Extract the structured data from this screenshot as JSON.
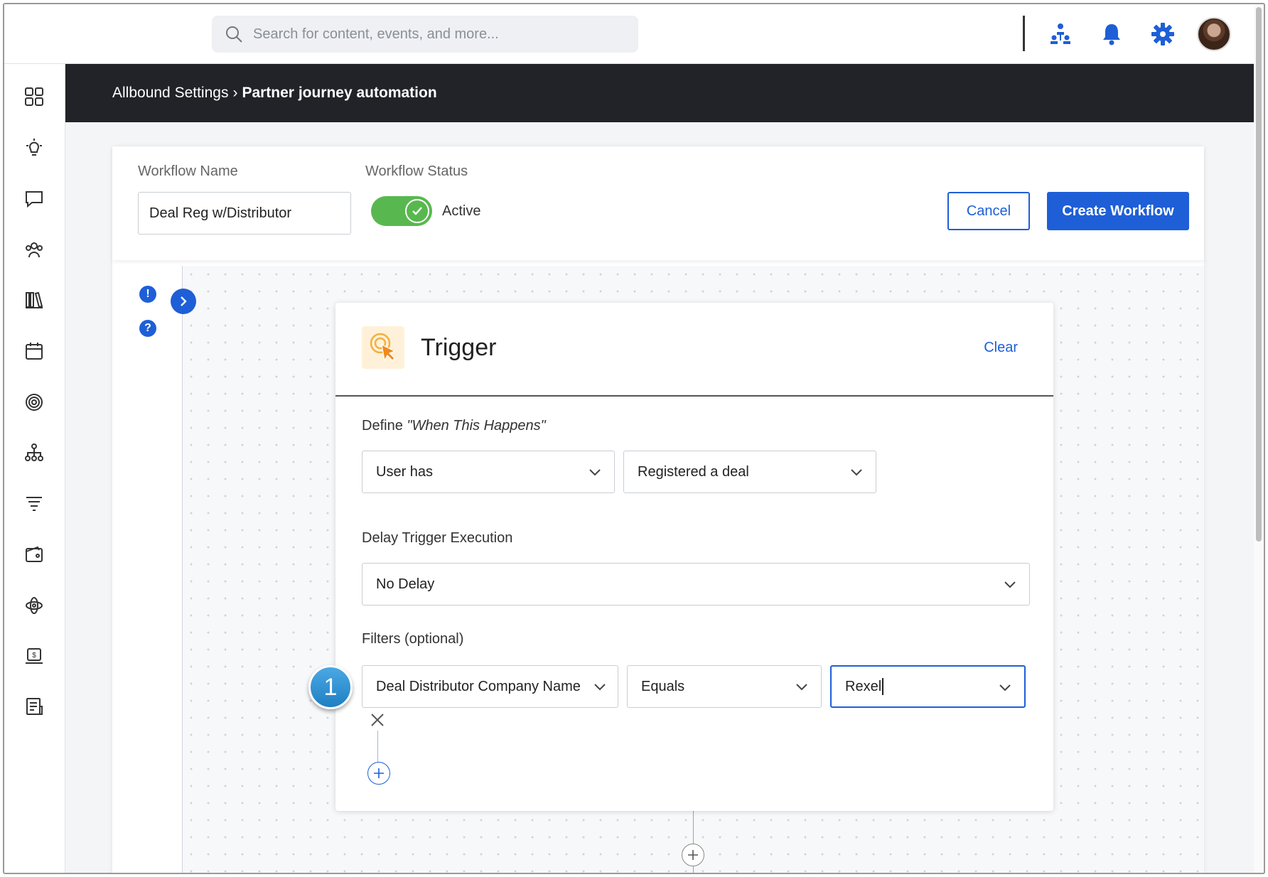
{
  "search": {
    "placeholder": "Search for content, events, and more..."
  },
  "topbar": {
    "icons": [
      "org-chart-icon",
      "bell-icon",
      "gear-icon",
      "user-avatar"
    ]
  },
  "sidebar": {
    "items": [
      "dashboard-icon",
      "lightbulb-icon",
      "chat-icon",
      "community-icon",
      "library-icon",
      "calendar-icon",
      "target-icon",
      "hierarchy-icon",
      "filter-icon",
      "wallet-icon",
      "integrations-icon",
      "payments-icon",
      "reports-icon"
    ]
  },
  "breadcrumb": {
    "parent": "Allbound Settings",
    "separator": "›",
    "current": "Partner journey automation"
  },
  "workflow": {
    "name_label": "Workflow Name",
    "name_value": "Deal Reg w/Distributor",
    "status_label": "Workflow Status",
    "status_value": "Active",
    "cancel_label": "Cancel",
    "create_label": "Create Workflow"
  },
  "canvas": {
    "alert_glyph": "!",
    "help_glyph": "?"
  },
  "trigger": {
    "title": "Trigger",
    "clear_label": "Clear",
    "define_prefix": "Define ",
    "define_emphasis": "\"When This Happens\"",
    "subject_select": "User has",
    "event_select": "Registered a deal",
    "delay_label": "Delay Trigger Execution",
    "delay_select": "No Delay",
    "filters_label": "Filters (optional)",
    "filter_field": "Deal Distributor Company Name",
    "filter_operator": "Equals",
    "filter_value": "Rexel"
  },
  "annotation": {
    "step_number": "1"
  },
  "colors": {
    "accent": "#1e5fd7",
    "toggle_on": "#58b84f",
    "header_bar": "#212328",
    "step_badge": "#2b8fd3"
  }
}
